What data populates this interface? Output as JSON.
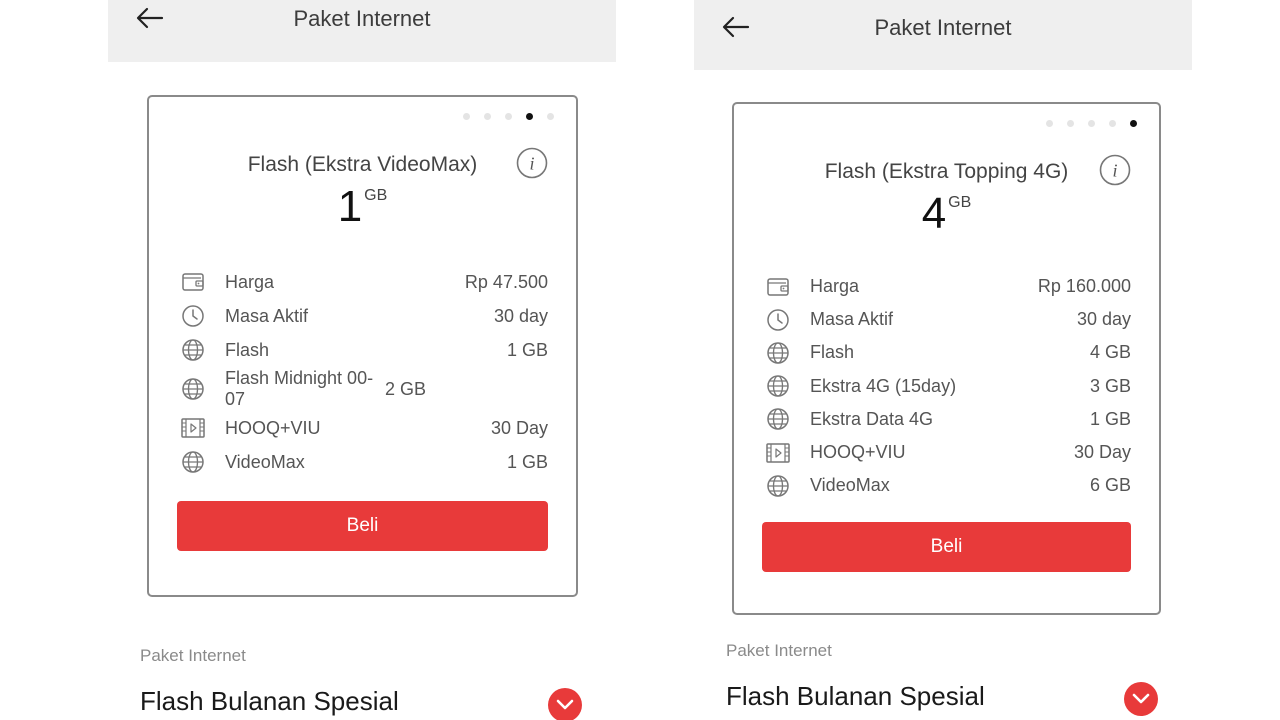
{
  "screens": [
    {
      "header": {
        "title": "Paket Internet",
        "back_icon": "arrow-left-icon"
      },
      "card": {
        "carousel": {
          "count": 5,
          "active_index": 3
        },
        "title": "Flash (Ekstra VideoMax)",
        "info_icon": "info-icon",
        "quota": {
          "value": "1",
          "unit": "GB"
        },
        "details": [
          {
            "icon": "wallet-icon",
            "label": "Harga",
            "value": "Rp 47.500"
          },
          {
            "icon": "clock-icon",
            "label": "Masa Aktif",
            "value": "30 day"
          },
          {
            "icon": "globe-icon",
            "label": "Flash",
            "value": "1 GB"
          },
          {
            "icon": "globe-icon",
            "label": "Flash Midnight 00-07",
            "value": "2 GB"
          },
          {
            "icon": "film-icon",
            "label": "HOOQ+VIU",
            "value": "30 Day"
          },
          {
            "icon": "globe-icon",
            "label": "VideoMax",
            "value": "1 GB"
          }
        ],
        "buy_label": "Beli"
      },
      "section": {
        "label": "Paket Internet",
        "title": "Flash Bulanan Spesial",
        "expand_icon": "chevron-down-icon"
      }
    },
    {
      "header": {
        "title": "Paket Internet",
        "back_icon": "arrow-left-icon"
      },
      "card": {
        "carousel": {
          "count": 5,
          "active_index": 4
        },
        "title": "Flash (Ekstra Topping 4G)",
        "info_icon": "info-icon",
        "quota": {
          "value": "4",
          "unit": "GB"
        },
        "details": [
          {
            "icon": "wallet-icon",
            "label": "Harga",
            "value": "Rp 160.000"
          },
          {
            "icon": "clock-icon",
            "label": "Masa Aktif",
            "value": "30 day"
          },
          {
            "icon": "globe-icon",
            "label": "Flash",
            "value": "4 GB"
          },
          {
            "icon": "globe-icon",
            "label": "Ekstra 4G (15day)",
            "value": "3 GB"
          },
          {
            "icon": "globe-icon",
            "label": "Ekstra Data 4G",
            "value": "1 GB"
          },
          {
            "icon": "film-icon",
            "label": "HOOQ+VIU",
            "value": "30 Day"
          },
          {
            "icon": "globe-icon",
            "label": "VideoMax",
            "value": "6 GB"
          }
        ],
        "buy_label": "Beli"
      },
      "section": {
        "label": "Paket Internet",
        "title": "Flash Bulanan Spesial",
        "expand_icon": "chevron-down-icon"
      }
    }
  ],
  "colors": {
    "accent": "#e83a3a",
    "header_bg": "#efefef",
    "card_border": "#8a8a8a"
  }
}
